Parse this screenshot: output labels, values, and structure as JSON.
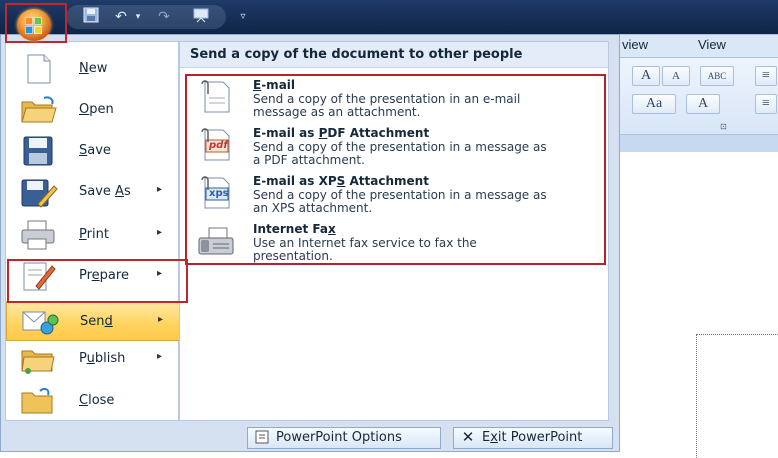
{
  "ribbon": {
    "tabs": [
      "view",
      "View"
    ],
    "row1": [
      "A",
      "A",
      "ABC"
    ],
    "row2": [
      "Aa",
      "A"
    ]
  },
  "menu": {
    "items": [
      {
        "label_pre": "",
        "label_ul": "N",
        "label_post": "ew",
        "has_arrow": false,
        "icon": "new-document-icon"
      },
      {
        "label_pre": "",
        "label_ul": "O",
        "label_post": "pen",
        "has_arrow": false,
        "icon": "open-folder-icon"
      },
      {
        "label_pre": "",
        "label_ul": "S",
        "label_post": "ave",
        "has_arrow": false,
        "icon": "save-disk-icon"
      },
      {
        "label_pre": "Save ",
        "label_ul": "A",
        "label_post": "s",
        "has_arrow": true,
        "icon": "save-as-icon"
      },
      {
        "label_pre": "",
        "label_ul": "P",
        "label_post": "rint",
        "has_arrow": true,
        "icon": "printer-icon"
      },
      {
        "label_pre": "Pr",
        "label_ul": "e",
        "label_post": "pare",
        "has_arrow": true,
        "icon": "prepare-icon"
      },
      {
        "label_pre": "Sen",
        "label_ul": "d",
        "label_post": "",
        "has_arrow": true,
        "icon": "send-icon"
      },
      {
        "label_pre": "P",
        "label_ul": "u",
        "label_post": "blish",
        "has_arrow": true,
        "icon": "publish-icon"
      },
      {
        "label_pre": "",
        "label_ul": "C",
        "label_post": "lose",
        "has_arrow": false,
        "icon": "close-folder-icon"
      }
    ],
    "arrow": "▸"
  },
  "panel": {
    "heading": "Send a copy of the document to other people",
    "options": [
      {
        "title_pre": "",
        "title_ul": "E",
        "title_post": "-mail",
        "desc": "Send a copy of the presentation in an e-mail message as an attachment.",
        "icon": "email-icon"
      },
      {
        "title_pre": "E-mail as ",
        "title_ul": "P",
        "title_post": "DF Attachment",
        "desc": "Send a copy of the presentation in a message as a PDF attachment.",
        "icon": "pdf-attachment-icon",
        "badge": "pdf"
      },
      {
        "title_pre": "E-mail as XP",
        "title_ul": "S",
        "title_post": " Attachment",
        "desc": "Send a copy of the presentation in a message as an XPS attachment.",
        "icon": "xps-attachment-icon",
        "badge": "xps"
      },
      {
        "title_pre": "Internet Fa",
        "title_ul": "x",
        "title_post": "",
        "desc": "Use an Internet fax service to fax the presentation.",
        "icon": "fax-machine-icon"
      }
    ]
  },
  "footer": {
    "options_label": "PowerPoint Options",
    "exit_pre": "E",
    "exit_ul": "x",
    "exit_post": "it PowerPoint"
  }
}
